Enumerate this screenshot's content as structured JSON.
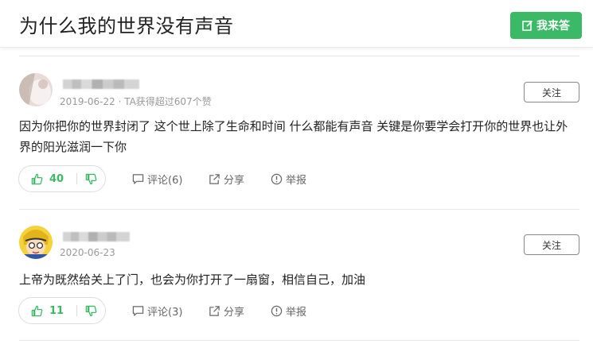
{
  "question": {
    "title": "为什么我的世界没有声音",
    "answer_button": "我来答"
  },
  "answers": [
    {
      "date": "2019-06-22",
      "stat": " · TA获得超过607个赞",
      "follow": "关注",
      "content": "因为你把你的世界封闭了 这个世上除了生命和时间 什么都能有声音 关键是你要学会打开你的世界也让外界的阳光滋润一下你",
      "likes": "40",
      "comment": "评论(6)",
      "share": "分享",
      "report": "举报"
    },
    {
      "date": "2020-06-23",
      "stat": "",
      "follow": "关注",
      "content": "上帝为既然给关上了门，也会为你打开了一扇窗，相信自己，加油",
      "likes": "11",
      "comment": "评论(3)",
      "share": "分享",
      "report": "举报"
    }
  ],
  "colors": {
    "accent": "#3bb966"
  }
}
